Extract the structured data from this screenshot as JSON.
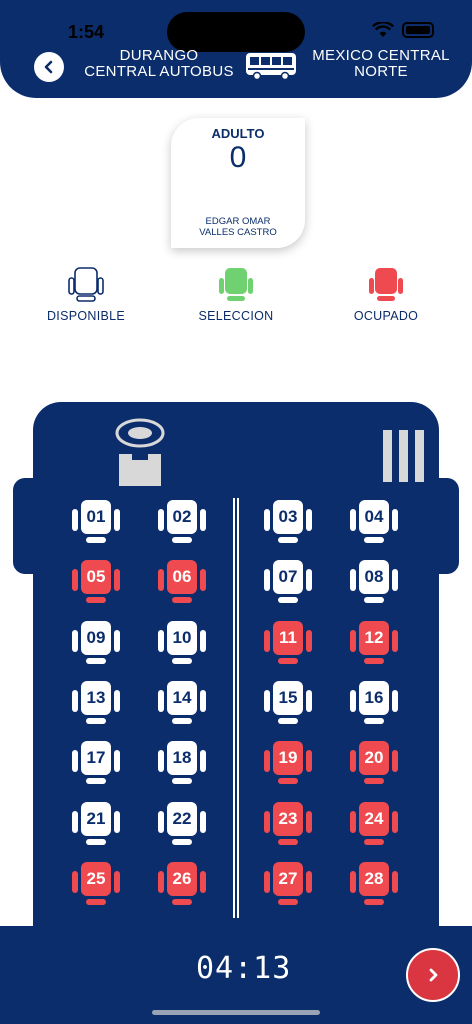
{
  "status_bar": {
    "time": "1:54"
  },
  "header": {
    "origin_line1": "DURANGO",
    "origin_line2": "CENTRAL AUTOBUS",
    "destination_line1": "MEXICO CENTRAL",
    "destination_line2": "NORTE",
    "back_icon": "chevron-left-icon",
    "bus_icon": "bus-icon"
  },
  "passenger": {
    "type": "ADULTO",
    "count": "0",
    "name_line1": "EDGAR OMAR",
    "name_line2": "VALLES CASTRO"
  },
  "legend": {
    "available": "DISPONIBLE",
    "selected": "SELECCION",
    "occupied": "OCUPADO"
  },
  "colors": {
    "brand_navy": "#0b2d6b",
    "available": "#ffffff",
    "selected": "#6fd16f",
    "occupied": "#ef4a4f"
  },
  "seats": [
    {
      "number": "01",
      "status": "available"
    },
    {
      "number": "02",
      "status": "available"
    },
    {
      "number": "03",
      "status": "available"
    },
    {
      "number": "04",
      "status": "available"
    },
    {
      "number": "05",
      "status": "occupied"
    },
    {
      "number": "06",
      "status": "occupied"
    },
    {
      "number": "07",
      "status": "available"
    },
    {
      "number": "08",
      "status": "available"
    },
    {
      "number": "09",
      "status": "available"
    },
    {
      "number": "10",
      "status": "available"
    },
    {
      "number": "11",
      "status": "occupied"
    },
    {
      "number": "12",
      "status": "occupied"
    },
    {
      "number": "13",
      "status": "available"
    },
    {
      "number": "14",
      "status": "available"
    },
    {
      "number": "15",
      "status": "available"
    },
    {
      "number": "16",
      "status": "available"
    },
    {
      "number": "17",
      "status": "available"
    },
    {
      "number": "18",
      "status": "available"
    },
    {
      "number": "19",
      "status": "occupied"
    },
    {
      "number": "20",
      "status": "occupied"
    },
    {
      "number": "21",
      "status": "available"
    },
    {
      "number": "22",
      "status": "available"
    },
    {
      "number": "23",
      "status": "occupied"
    },
    {
      "number": "24",
      "status": "occupied"
    },
    {
      "number": "25",
      "status": "occupied"
    },
    {
      "number": "26",
      "status": "occupied"
    },
    {
      "number": "27",
      "status": "occupied"
    },
    {
      "number": "28",
      "status": "occupied"
    }
  ],
  "footer": {
    "timer": "04:13",
    "next_icon": "chevron-right-icon"
  }
}
